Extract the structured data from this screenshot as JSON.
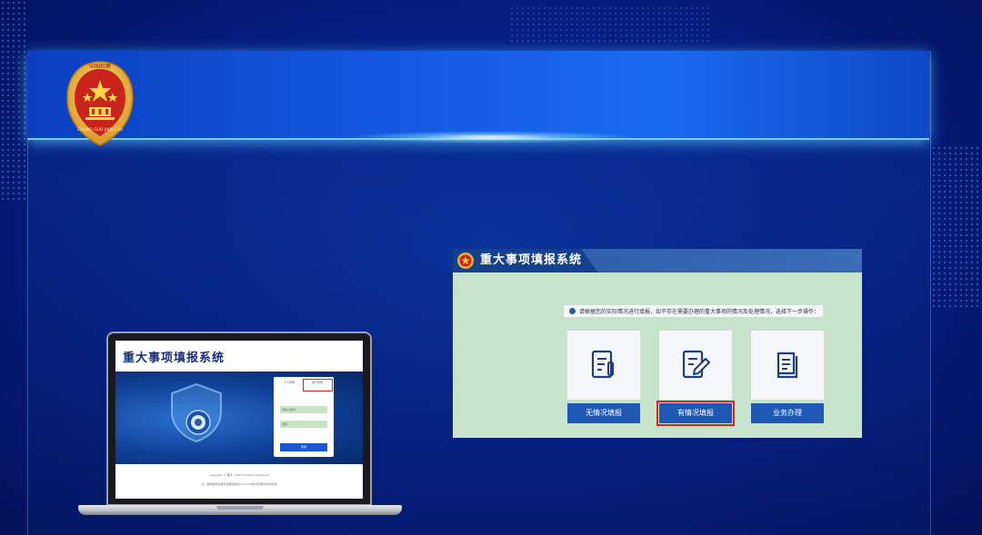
{
  "emblem": {
    "ring_text": "ZHONG GUO JIAN CHA",
    "top_text": "中国检察"
  },
  "laptop": {
    "app_title": "重大事项填报系统",
    "login": {
      "tab_personal": "个人登录",
      "tab_account": "用户登录",
      "username_placeholder": "请输入账号",
      "password_placeholder": "密码",
      "login_button": "登录"
    },
    "footer": {
      "copyright": "Copyright © 重庆 · 2022 All Rights Reserved",
      "notice": "注：推荐使用谷歌浏览器或其他chrome内核浏览器访问本系统"
    }
  },
  "app": {
    "title": "重大事项填报系统",
    "notice": "请根据您的实际情况进行填报，如不存在需要办理的重大事项的情况及处理情况，选择下一步操作：",
    "cards": [
      {
        "label": "无情况填报",
        "icon": "form-icon",
        "highlighted": false
      },
      {
        "label": "有情况填报",
        "icon": "edit-icon",
        "highlighted": true
      },
      {
        "label": "业务办理",
        "icon": "book-icon",
        "highlighted": false
      }
    ]
  },
  "colors": {
    "header_blue": "#1558e0",
    "app_panel_green": "#c8e3cc",
    "button_blue": "#1f58b4",
    "highlight_red": "#e02020"
  }
}
